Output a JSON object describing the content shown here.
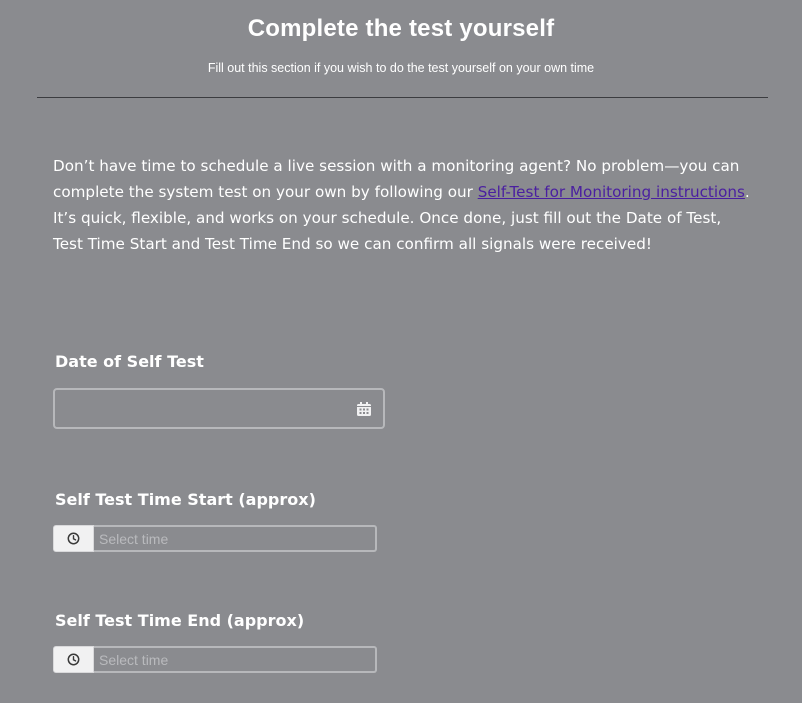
{
  "section": {
    "title": "Complete the test yourself",
    "subtitle": "Fill out this section if you wish to do the test yourself on your own time"
  },
  "intro": {
    "before_link": "Don’t have time to schedule a live session with a monitoring agent? No problem—you can complete the system test on your own by following our ",
    "link_text": "Self-Test for Monitoring instructions",
    "after_link": ". It’s quick, flexible, and works on your schedule. Once done, just fill out the Date of Test, Test Time Start and Test Time End so we can confirm all signals were received!"
  },
  "fields": {
    "date": {
      "label": "Date of Self Test",
      "value": "",
      "icon": "calendar-icon"
    },
    "time_start": {
      "label": "Self Test Time Start (approx)",
      "placeholder": "Select time",
      "value": "",
      "icon": "clock-icon"
    },
    "time_end": {
      "label": "Self Test Time End (approx)",
      "placeholder": "Select time",
      "value": "",
      "icon": "clock-icon"
    }
  },
  "colors": {
    "background": "#8a8b8f",
    "text": "#ffffff",
    "link": "#4a1fa0",
    "divider": "#3b3c40",
    "input_border": "#b7b8bb",
    "addon_background": "#f1f1f2"
  }
}
